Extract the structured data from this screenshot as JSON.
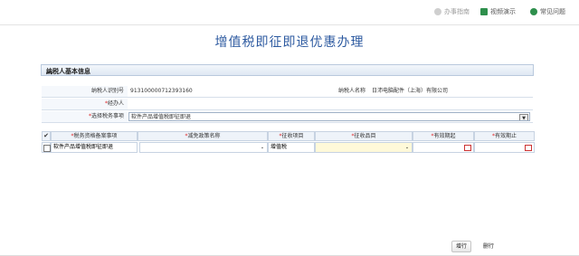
{
  "toplinks": {
    "guide": "办事指南",
    "video": "视频演示",
    "faq": "常见问题"
  },
  "title": "增值税即征即退优惠办理",
  "panel": {
    "header": "纳税人基本信息",
    "taxpayer_id_label": "纳税人识别号",
    "taxpayer_id_value": "913100000712393160",
    "taxpayer_name_label": "纳税人名称",
    "taxpayer_name_value": "日沛电脑配件（上海）有限公司",
    "agent_label": "经办人",
    "matter_label": "选择税务事项",
    "matter_value": "软件产品增值税即征即退"
  },
  "grid": {
    "headers": [
      "税务资格备案事项",
      "减免政策名称",
      "征收项目",
      "征收品目",
      "有效期起",
      "有效期止"
    ],
    "row": {
      "item": "软件产品增值税即征即退",
      "policy": "",
      "levy_item": "增值税",
      "levy_subitem": "",
      "start": "",
      "end": ""
    }
  },
  "buttons": {
    "add": "增行",
    "delete": "删行"
  }
}
